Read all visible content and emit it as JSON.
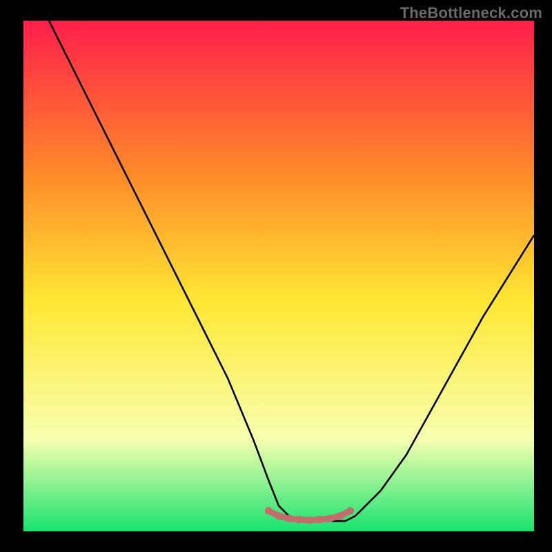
{
  "watermark": "TheBottleneck.com",
  "chart_data": {
    "type": "line",
    "title": "",
    "xlabel": "",
    "ylabel": "",
    "xlim": [
      0,
      100
    ],
    "ylim": [
      0,
      100
    ],
    "background_gradient": {
      "top_color": "#ff1f4a",
      "mid_upper_color": "#ff8a2a",
      "mid_color": "#ffe733",
      "lower_color": "#f7ffb0",
      "bottom_color": "#17e36e"
    },
    "series": [
      {
        "name": "bottleneck-curve",
        "stroke": "#000000",
        "x": [
          5,
          10,
          15,
          20,
          25,
          30,
          35,
          40,
          45,
          48,
          50,
          52,
          55,
          58,
          60,
          63,
          65,
          70,
          75,
          80,
          85,
          90,
          95,
          100
        ],
        "y": [
          100,
          90,
          80,
          70,
          60,
          50,
          40,
          30,
          18,
          10,
          5,
          3,
          2,
          2,
          2,
          2,
          3,
          8,
          15,
          24,
          33,
          42,
          50,
          58
        ]
      },
      {
        "name": "optimal-zone-marker",
        "stroke": "#c26d6d",
        "x": [
          48,
          50,
          52,
          54,
          56,
          58,
          60,
          62,
          64
        ],
        "y": [
          4,
          3,
          2.5,
          2.3,
          2.2,
          2.3,
          2.5,
          3,
          4
        ]
      }
    ],
    "annotations": []
  }
}
